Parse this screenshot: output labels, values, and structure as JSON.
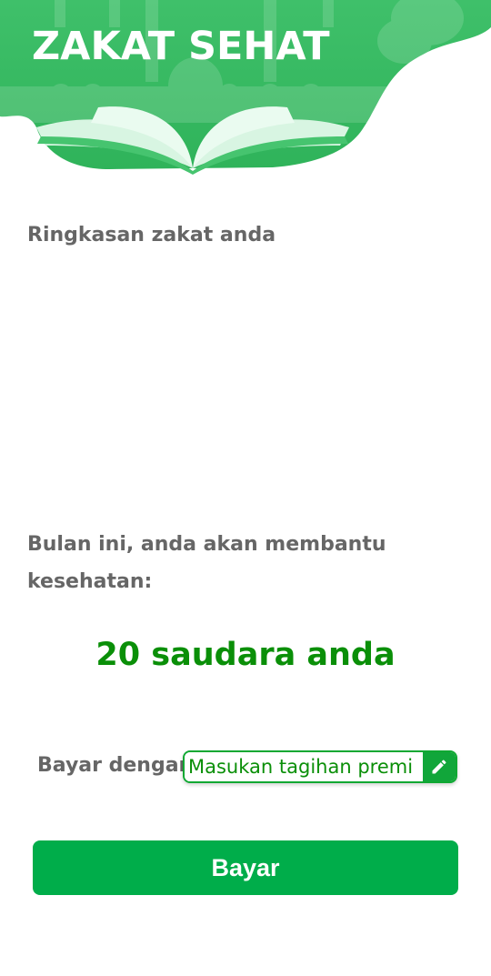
{
  "header": {
    "title": "ZAKAT SEHAT"
  },
  "summary": {
    "heading": "Ringkasan zakat anda"
  },
  "impact": {
    "text": "Bulan ini, anda akan membantu kesehatan:",
    "count_text": "20 saudara anda"
  },
  "payment": {
    "label": "Bayar dengan",
    "premi_placeholder": "Masukan tagihan premi",
    "edit_icon": "pencil-icon",
    "pay_button": "Bayar"
  },
  "colors": {
    "brand_green": "#34b85c",
    "accent_green": "#0a8f08",
    "button_green": "#00ad4a",
    "text_gray": "#666666"
  }
}
